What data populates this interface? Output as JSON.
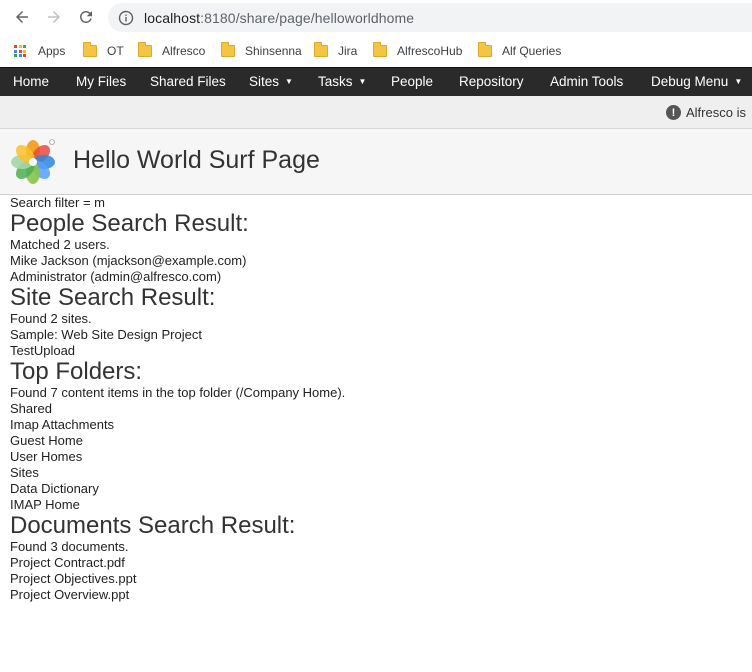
{
  "browser": {
    "url_host": "localhost",
    "url_path": ":8180/share/page/helloworldhome",
    "bookmarks": [
      "Apps",
      "OT",
      "Alfresco",
      "Shinsenna",
      "Jira",
      "AlfrescoHub",
      "Alf Queries"
    ]
  },
  "menu": {
    "items": [
      {
        "label": "Home",
        "caret": false
      },
      {
        "label": "My Files",
        "caret": false
      },
      {
        "label": "Shared Files",
        "caret": false
      },
      {
        "label": "Sites",
        "caret": true
      },
      {
        "label": "Tasks",
        "caret": true
      },
      {
        "label": "People",
        "caret": false
      },
      {
        "label": "Repository",
        "caret": false
      },
      {
        "label": "Admin Tools",
        "caret": false
      },
      {
        "label": "Debug Menu",
        "caret": true
      }
    ]
  },
  "notice": {
    "text": "Alfresco is"
  },
  "page": {
    "title": "Hello World Surf Page"
  },
  "content": {
    "search_filter": "Search filter = m",
    "people": {
      "heading": "People Search Result:",
      "summary": "Matched 2 users.",
      "items": [
        "Mike Jackson (mjackson@example.com)",
        "Administrator (admin@alfresco.com)"
      ]
    },
    "sites": {
      "heading": "Site Search Result:",
      "summary": "Found 2 sites.",
      "items": [
        "Sample: Web Site Design Project",
        "TestUpload"
      ]
    },
    "folders": {
      "heading": "Top Folders:",
      "summary": "Found 7 content items in the top folder (/Company Home).",
      "items": [
        "Shared",
        "Imap Attachments",
        "Guest Home",
        "User Homes",
        "Sites",
        "Data Dictionary",
        "IMAP Home"
      ]
    },
    "documents": {
      "heading": "Documents Search Result:",
      "summary": "Found 3 documents.",
      "items": [
        "Project Contract.pdf",
        "Project Objectives.ppt",
        "Project Overview.ppt"
      ]
    }
  },
  "colors": {
    "menubar_bg": "#2a2a2a",
    "notice_bg": "#efefef",
    "title_bg": "#f6f6f6",
    "folder_icon": "#f4c542"
  },
  "icons": [
    "back-icon",
    "forward-icon",
    "reload-icon",
    "info-icon",
    "apps-grid-icon",
    "folder-icon",
    "warning-icon",
    "alfresco-logo"
  ]
}
